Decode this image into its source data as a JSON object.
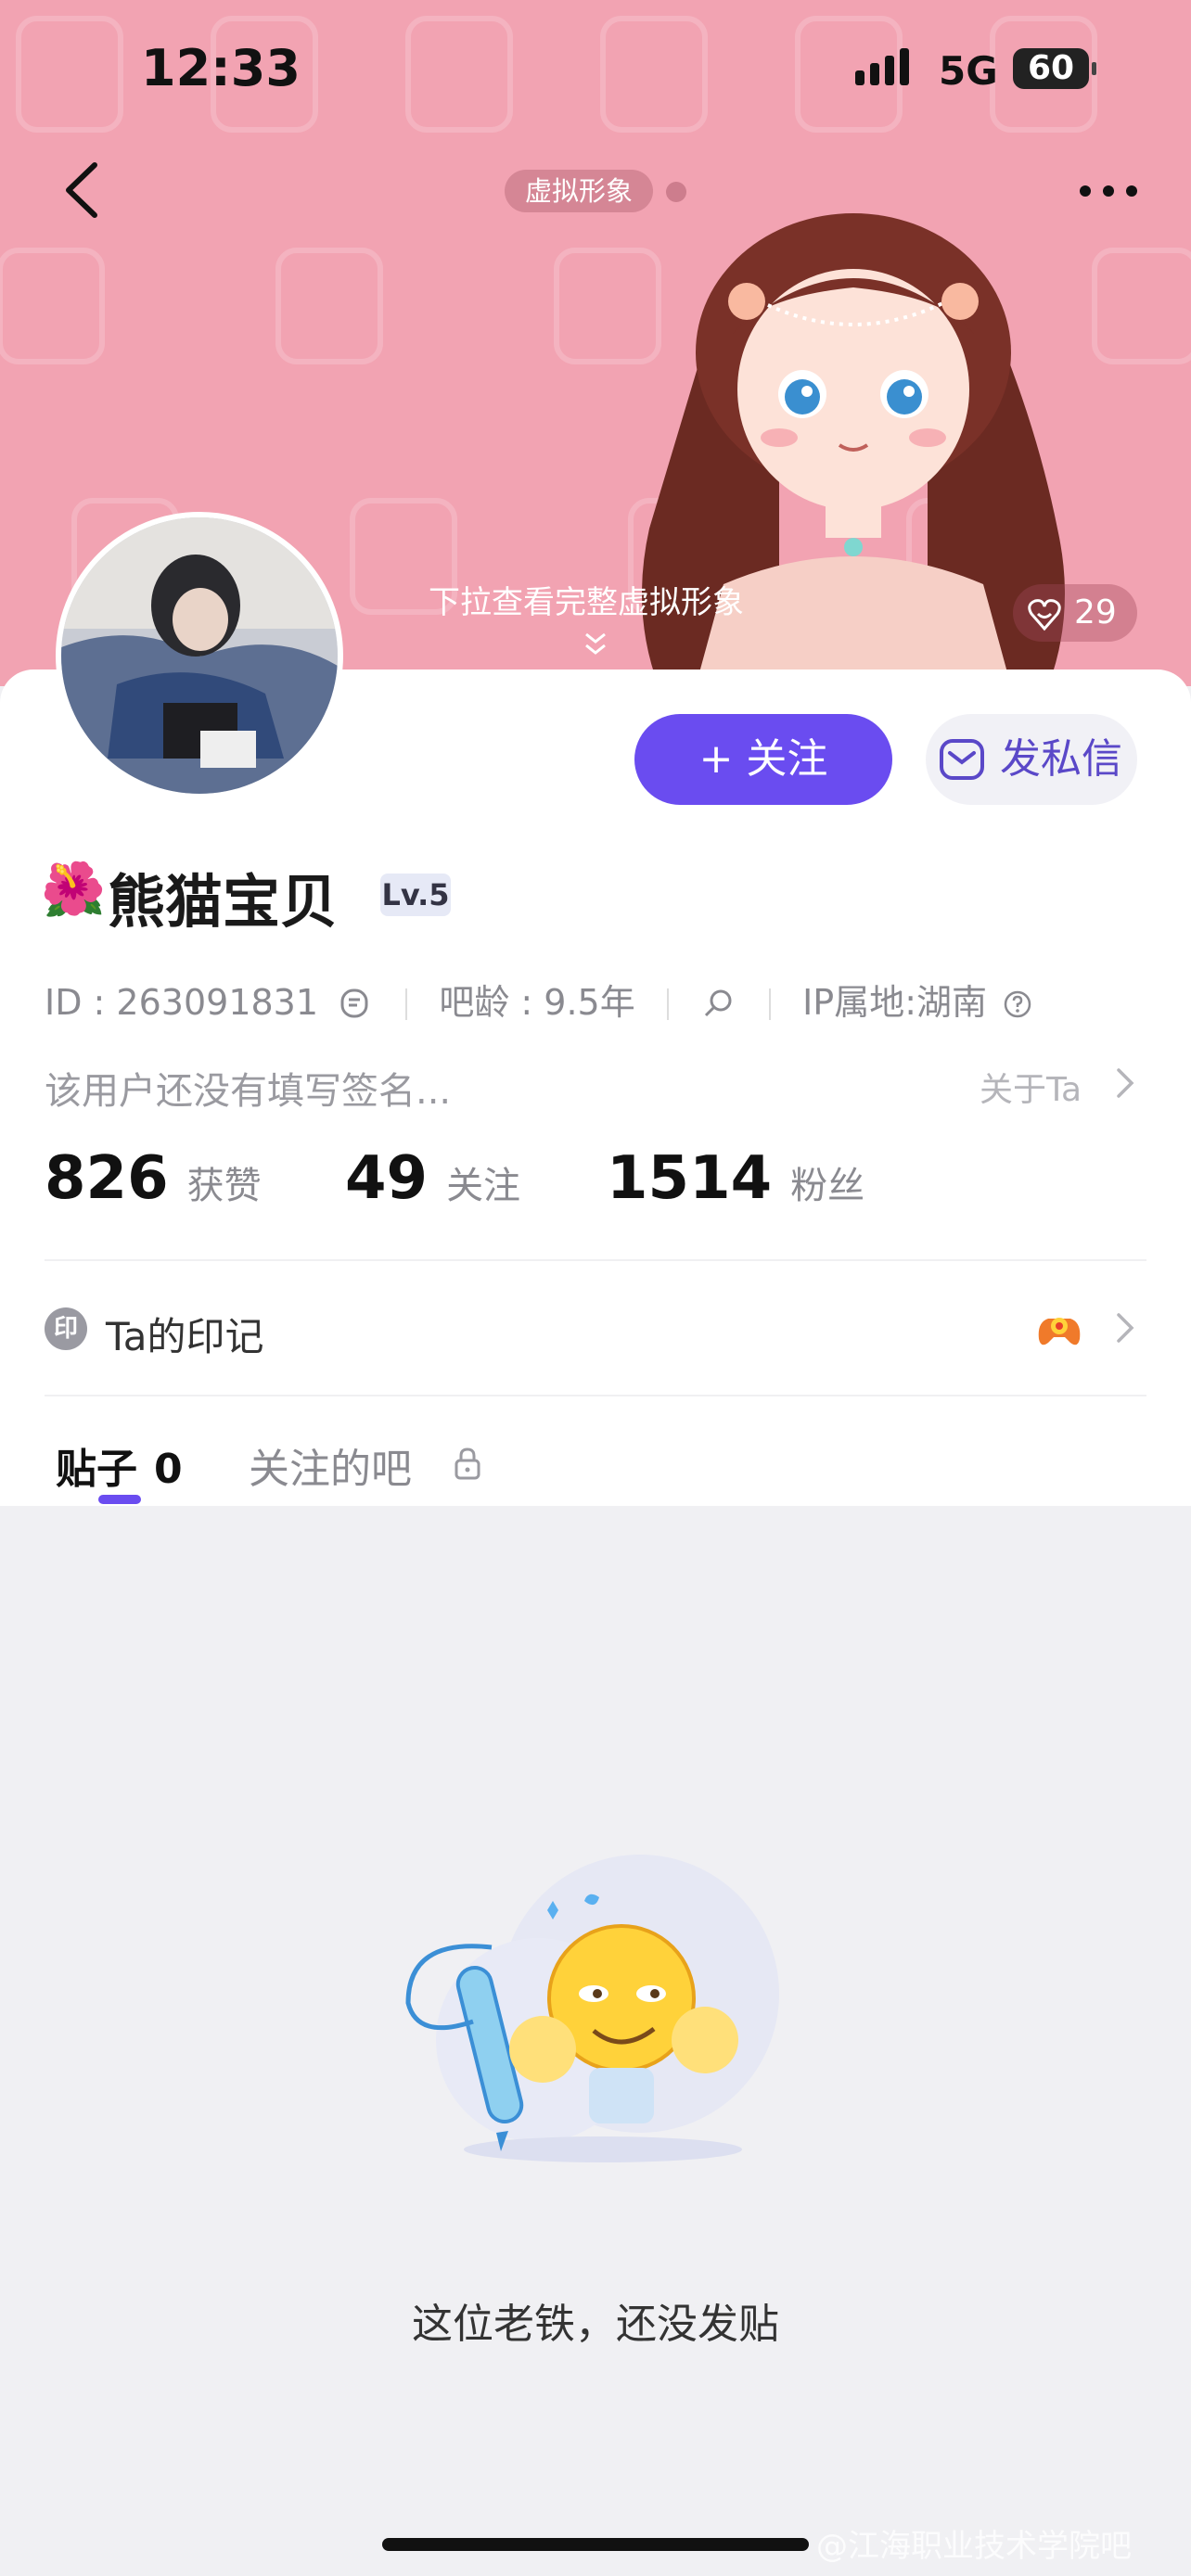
{
  "status_bar": {
    "time": "12:33",
    "network": "5G",
    "battery": "60"
  },
  "header": {
    "avatar_chip": "虚拟形象",
    "pull_hint": "下拉查看完整虚拟形象",
    "like_count": "29"
  },
  "profile": {
    "follow_label": "+ 关注",
    "message_label": "发私信",
    "name_emoji": "🌺",
    "name": "熊猫宝贝",
    "level": "Lv.5",
    "id_text": "ID : 263091831",
    "tieba_age": "吧龄 : 9.5年",
    "ip_location": "IP属地:湖南",
    "signature": "该用户还没有填写签名...",
    "about_label": "关于Ta",
    "stats": [
      {
        "value": "826",
        "label": "获赞"
      },
      {
        "value": "49",
        "label": "关注"
      },
      {
        "value": "1514",
        "label": "粉丝"
      }
    ]
  },
  "marks": {
    "icon_text": "印",
    "label": "Ta的印记"
  },
  "tabs": [
    {
      "label": "贴子",
      "count": "0"
    },
    {
      "label": "关注的吧"
    }
  ],
  "empty_state": {
    "text": "这位老铁，还没发贴"
  },
  "watermark": "@江海职业技术学院吧",
  "colors": {
    "accent": "#6a4cf0",
    "hero_bg": "#f2a3b2",
    "page_bg": "#f0f0f3"
  }
}
